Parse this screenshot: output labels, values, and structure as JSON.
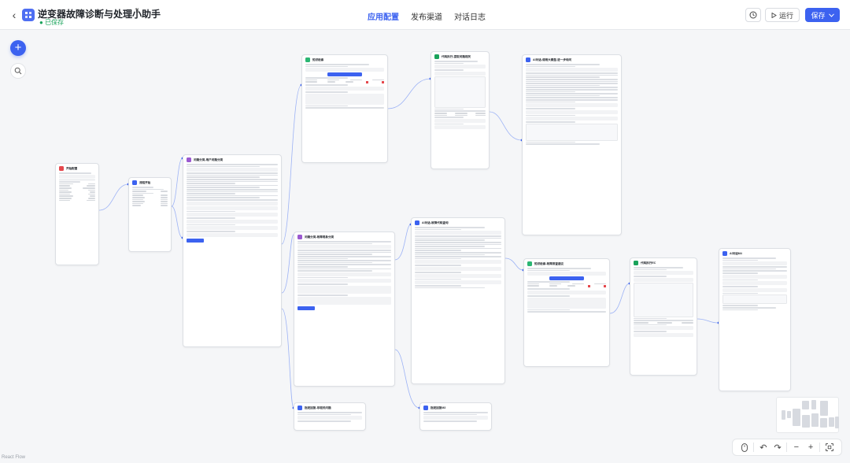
{
  "app": {
    "title": "逆变器故障诊断与处理小助手",
    "save_status": "已保存"
  },
  "tabs": [
    {
      "label": "应用配置",
      "active": true
    },
    {
      "label": "发布渠道",
      "active": false
    },
    {
      "label": "对话日志",
      "active": false
    }
  ],
  "toolbar": {
    "run_label": "运行",
    "publish_label": "保存"
  },
  "nodes": [
    {
      "id": "start-config",
      "title": "开始配置",
      "color": "#e5484d"
    },
    {
      "id": "flow-start",
      "title": "流程开始",
      "color": "#3c62f0"
    },
    {
      "id": "q-classify-1",
      "title": "问题分类-用户问题分类",
      "color": "#9b59d0"
    },
    {
      "id": "kb-search",
      "title": "知识检索",
      "color": "#2bb673"
    },
    {
      "id": "code-1",
      "title": "代码执行-提取问题相关",
      "color": "#1aa35b"
    },
    {
      "id": "ai-reply-1",
      "title": "AI对话-调用大模型-进一步询问",
      "color": "#3c62f0"
    },
    {
      "id": "q-classify-2",
      "title": "问题分类-故障现象分类",
      "color": "#9b59d0"
    },
    {
      "id": "ai-reply-2",
      "title": "AI对话-故障代码查询",
      "color": "#3c62f0"
    },
    {
      "id": "kb-search-2",
      "title": "知识检索-故障排查建议",
      "color": "#2bb673"
    },
    {
      "id": "code-2",
      "title": "代码执行EC",
      "color": "#1aa35b"
    },
    {
      "id": "ai-reply-3",
      "title": "AI对话M4",
      "color": "#3c62f0"
    },
    {
      "id": "fixed-reply-1",
      "title": "指定回复-非相关问题",
      "color": "#3c62f0"
    },
    {
      "id": "fixed-reply-2",
      "title": "指定回复M3",
      "color": "#3c62f0"
    }
  ],
  "footer": {
    "label": "React Flow"
  }
}
